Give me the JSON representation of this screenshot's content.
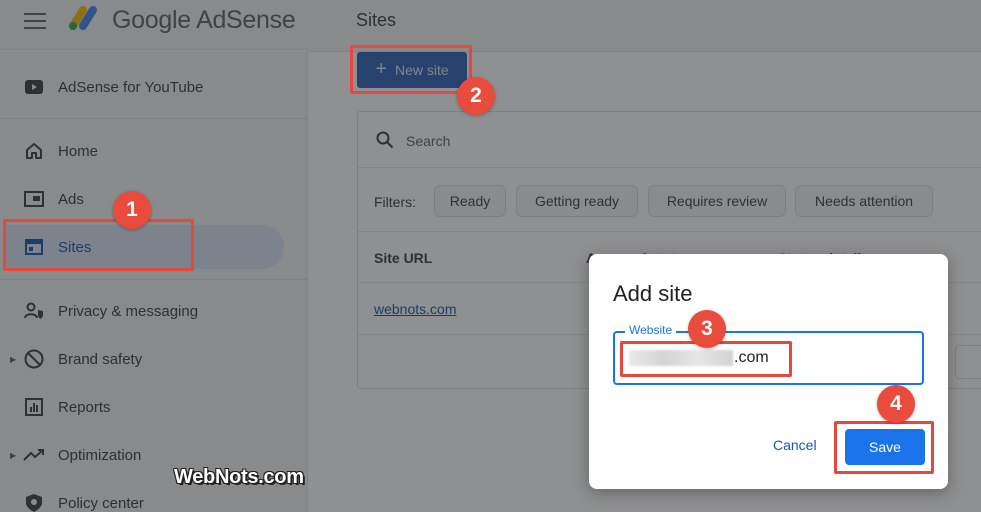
{
  "header": {
    "brand": "Google AdSense",
    "page_title": "Sites"
  },
  "sidebar": {
    "items": [
      {
        "label": "AdSense for YouTube",
        "icon": "youtube-icon"
      },
      {
        "label": "Home",
        "icon": "home-icon"
      },
      {
        "label": "Ads",
        "icon": "ads-icon"
      },
      {
        "label": "Sites",
        "icon": "sites-icon",
        "active": true
      },
      {
        "label": "Privacy & messaging",
        "icon": "privacy-icon"
      },
      {
        "label": "Brand safety",
        "icon": "block-icon"
      },
      {
        "label": "Reports",
        "icon": "reports-icon"
      },
      {
        "label": "Optimization",
        "icon": "trend-icon"
      },
      {
        "label": "Policy center",
        "icon": "policy-icon"
      }
    ]
  },
  "main": {
    "new_site_label": "New site",
    "search_placeholder": "Search",
    "filters_label": "Filters:",
    "filters": [
      "Ready",
      "Getting ready",
      "Requires review",
      "Needs attention"
    ],
    "columns": [
      "Site URL",
      "Approval status",
      "Status details"
    ],
    "rows": [
      {
        "url": "webnots.com"
      }
    ]
  },
  "dialog": {
    "title": "Add site",
    "field_label": "Website",
    "field_value_suffix": ".com",
    "cancel_label": "Cancel",
    "save_label": "Save"
  },
  "annotations": {
    "badges": [
      "1",
      "2",
      "3",
      "4"
    ],
    "watermark": "WebNots.com"
  },
  "colors": {
    "accent": "#1a73e8",
    "annotation": "#e5483c",
    "active_nav_bg": "#dbe5f5"
  }
}
